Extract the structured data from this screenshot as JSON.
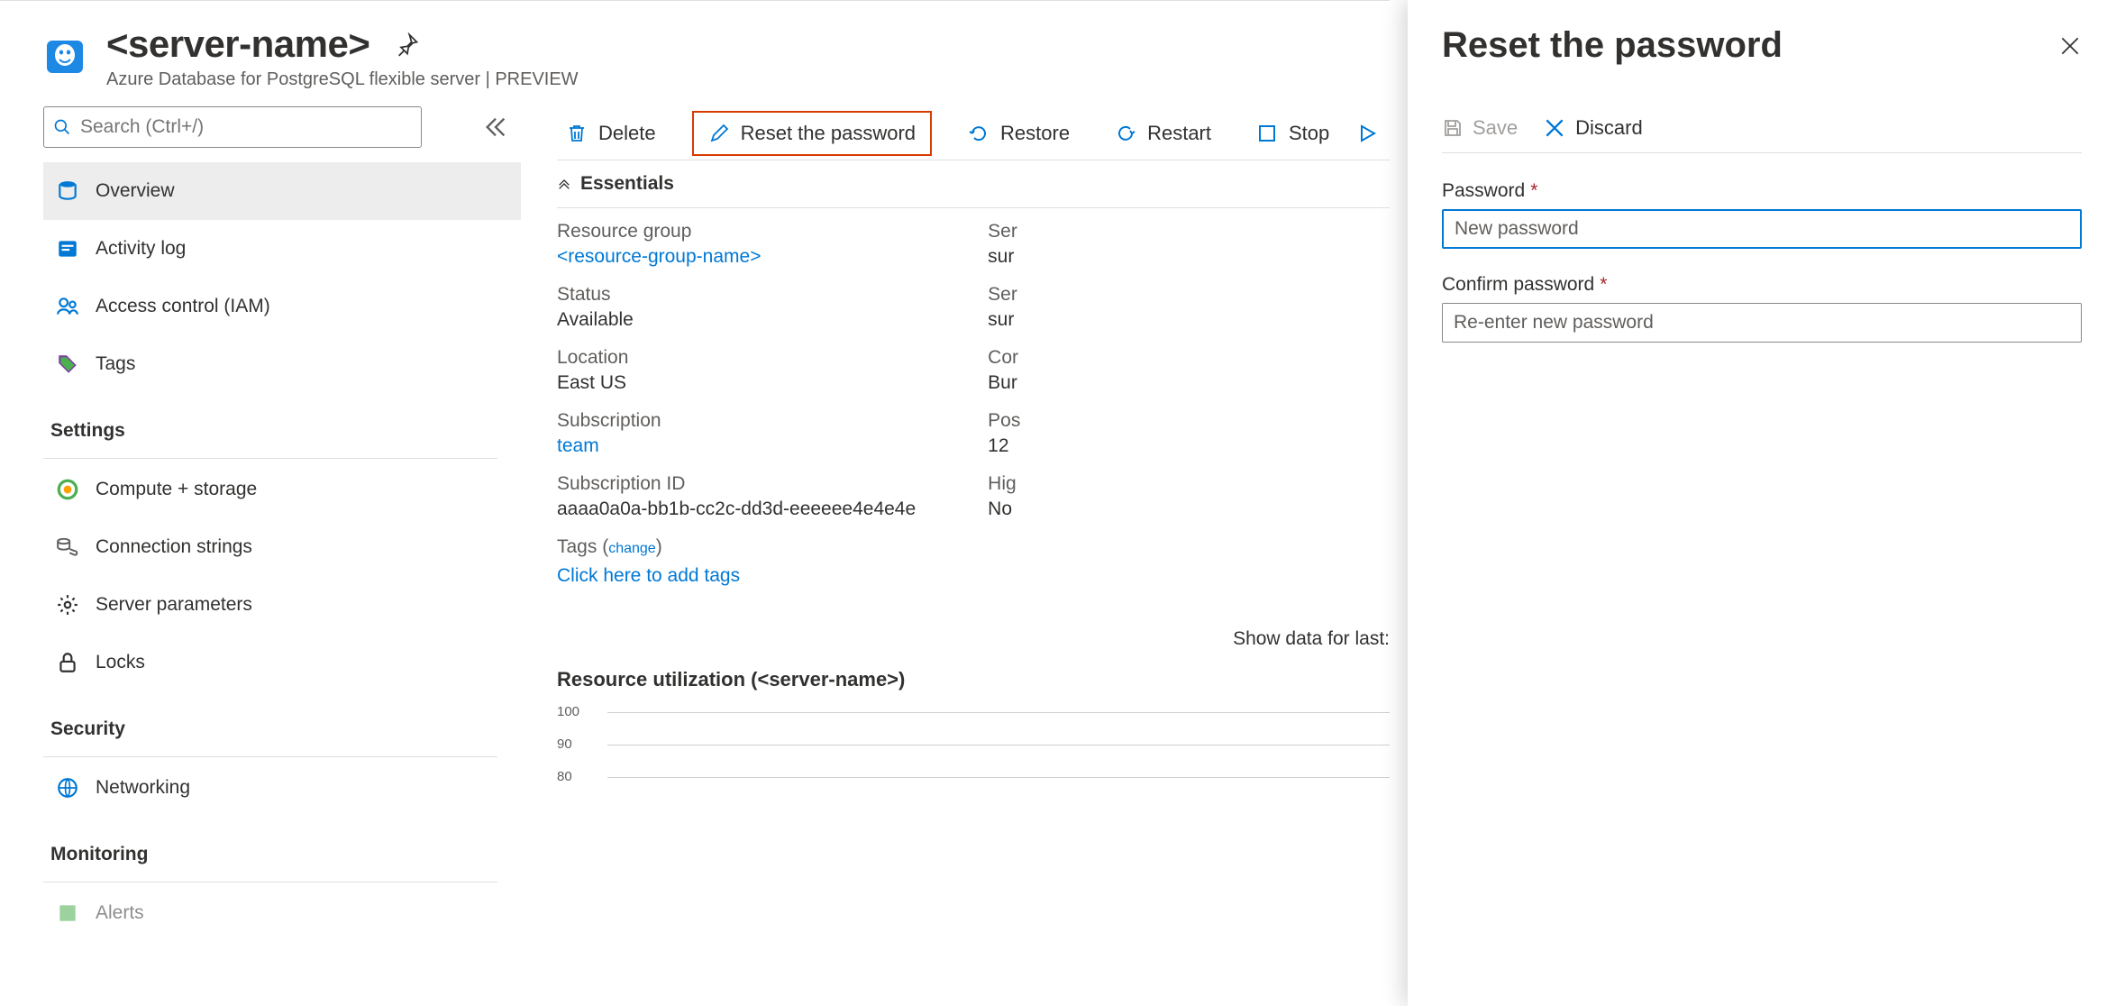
{
  "header": {
    "title": "<server-name>",
    "subtitle": "Azure Database for PostgreSQL flexible server | PREVIEW"
  },
  "search_placeholder": "Search (Ctrl+/)",
  "nav": {
    "overview": "Overview",
    "activitylog": "Activity log",
    "iam": "Access control (IAM)",
    "tags": "Tags",
    "settings_head": "Settings",
    "compute": "Compute + storage",
    "connstrings": "Connection strings",
    "params": "Server parameters",
    "locks": "Locks",
    "security_head": "Security",
    "networking": "Networking",
    "monitoring_head": "Monitoring",
    "alerts": "Alerts"
  },
  "toolbar": {
    "delete": "Delete",
    "reset": "Reset the password",
    "restore": "Restore",
    "restart": "Restart",
    "stop": "Stop"
  },
  "essentials_heading": "Essentials",
  "essentials": {
    "labels": {
      "rg": "Resource group",
      "status": "Status",
      "location": "Location",
      "sub": "Subscription",
      "subid": "Subscription ID",
      "tags": "Tags (",
      "change": "change",
      "tags_close": ")",
      "addtags": "Click here to add tags"
    },
    "values": {
      "rg": "<resource-group-name>",
      "status": "Available",
      "location": "East US",
      "sub": "team",
      "subid": "aaaa0a0a-bb1b-cc2c-dd3d-eeeeee4e4e4e"
    },
    "rlabels": {
      "server": "Ser",
      "server2": "Ser",
      "comp": "Cor",
      "pgver": "Pos",
      "ha": "Hig"
    },
    "rvalues": {
      "server": "sur",
      "server2": "sur",
      "comp": "Bur",
      "pgver": "12",
      "ha": "No"
    }
  },
  "showdata": "Show data for last:",
  "chart": {
    "title": "Resource utilization (<server-name>)",
    "ticks": [
      "100",
      "90",
      "80"
    ]
  },
  "chart_data": {
    "type": "line",
    "title": "Resource utilization (<server-name>)",
    "ylim": [
      0,
      100
    ],
    "yticks_visible": [
      100,
      90,
      80
    ],
    "series": [],
    "note": "only gridlines/y-axis ticks visible in screenshot; no plotted data shown"
  },
  "panel": {
    "title": "Reset the password",
    "save": "Save",
    "discard": "Discard",
    "password_label": "Password",
    "confirm_label": "Confirm password",
    "password_placeholder": "New password",
    "confirm_placeholder": "Re-enter new password"
  }
}
